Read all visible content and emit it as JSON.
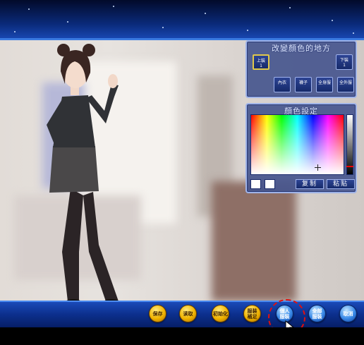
{
  "colors": {
    "panel_bg": "#46568e",
    "panel_border": "#a0b4e8",
    "bar_blue": "#0c2f8c",
    "gold_button": "#f0b400",
    "blue_button": "#3a8ae8",
    "highlight": "#e01010"
  },
  "part_panel": {
    "title": "改變顏色的地方",
    "parts": [
      {
        "label": "上裝\n1",
        "selected": true
      },
      {
        "label": "下裝\n1",
        "selected": false
      },
      {
        "label": "內衣",
        "selected": false
      },
      {
        "label": "襪子",
        "selected": false
      },
      {
        "label": "全身服",
        "selected": false
      },
      {
        "label": "全外服",
        "selected": false
      }
    ]
  },
  "color_panel": {
    "title": "顏色設定",
    "copy_label": "复制",
    "paste_label": "粘贴"
  },
  "toolbar": {
    "buttons": [
      {
        "label": "保存",
        "style": "gold",
        "icon": "save"
      },
      {
        "label": "读取",
        "style": "gold",
        "icon": "load"
      },
      {
        "label": "初始化",
        "style": "gold",
        "icon": "reset"
      },
      {
        "label": "服装\n補足",
        "style": "gold",
        "icon": "supplement"
      },
      {
        "label": "個人\n服裝",
        "style": "blue",
        "icon": "personal-outfit"
      },
      {
        "label": "全部\n服裝",
        "style": "blue",
        "icon": "all-outfit"
      },
      {
        "label": "取消",
        "style": "blue",
        "icon": "cancel"
      }
    ]
  }
}
